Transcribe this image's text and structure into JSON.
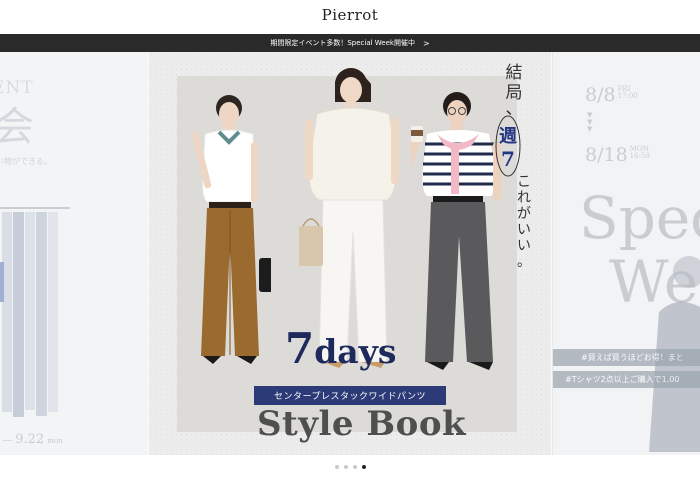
{
  "header": {
    "logo": "Pierrot"
  },
  "announcement": {
    "text": "期間限定イベント多数！Special Week開催中",
    "chevron": ">"
  },
  "slide_left": {
    "line1": "ENT",
    "line2": "会",
    "line3": "い物ができる。",
    "date_start": "",
    "date_dash": "—",
    "date_end": "9.22",
    "date_day": "mon"
  },
  "slide_main": {
    "vertical_copy": "結局、週7これがいい。",
    "title_number": "7",
    "title_word": "days",
    "ribbon": "センタープレスタックワイドパンツ",
    "subtitle": "Style Book"
  },
  "slide_right": {
    "date1": "8/8",
    "date1_day": "FRI",
    "date1_time": "17:00",
    "date2": "8/18",
    "date2_day": "MON",
    "date2_time": "16:59",
    "big1": "Spec",
    "big2": "We",
    "banner1": "#買えば買うほどお得！まと",
    "banner2": "#Tシャツ2点以上ご購入で1,00"
  },
  "pager": {
    "count": 4,
    "active_index": 3
  },
  "colors": {
    "navy": "#1f2a5c",
    "ribbon": "#2d3a78",
    "bar": "#2a2a2a"
  }
}
